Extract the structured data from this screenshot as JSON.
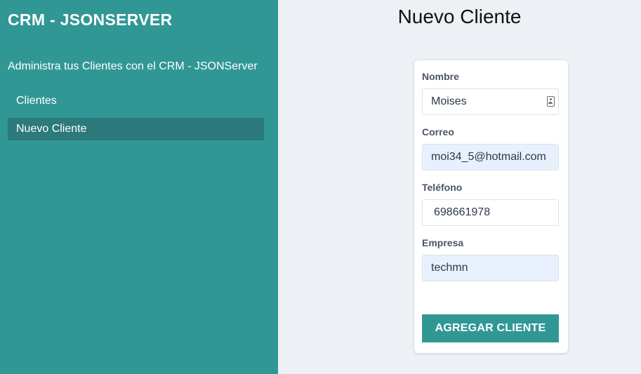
{
  "sidebar": {
    "brand": "CRM - JSONSERVER",
    "tagline": "Administra tus Clientes con el CRM - JSONServer",
    "nav": [
      {
        "label": "Clientes",
        "active": false
      },
      {
        "label": "Nuevo Cliente",
        "active": true
      }
    ]
  },
  "main": {
    "title": "Nuevo Cliente",
    "form": {
      "nombre": {
        "label": "Nombre",
        "value": "Moises"
      },
      "correo": {
        "label": "Correo",
        "value": "moi34_5@hotmail.com"
      },
      "telefono": {
        "label": "Teléfono",
        "value": "698661978"
      },
      "empresa": {
        "label": "Empresa",
        "value": "techmn"
      },
      "submit_label": "AGREGAR CLIENTE"
    }
  },
  "colors": {
    "sidebar_bg": "#319795",
    "nav_active_bg": "#2c7a7b",
    "button_bg": "#319795",
    "autofill_bg": "#e8f0fe",
    "page_bg": "#edf1f5"
  },
  "icons": {
    "nombre_field_icon": "contact-card-icon"
  }
}
